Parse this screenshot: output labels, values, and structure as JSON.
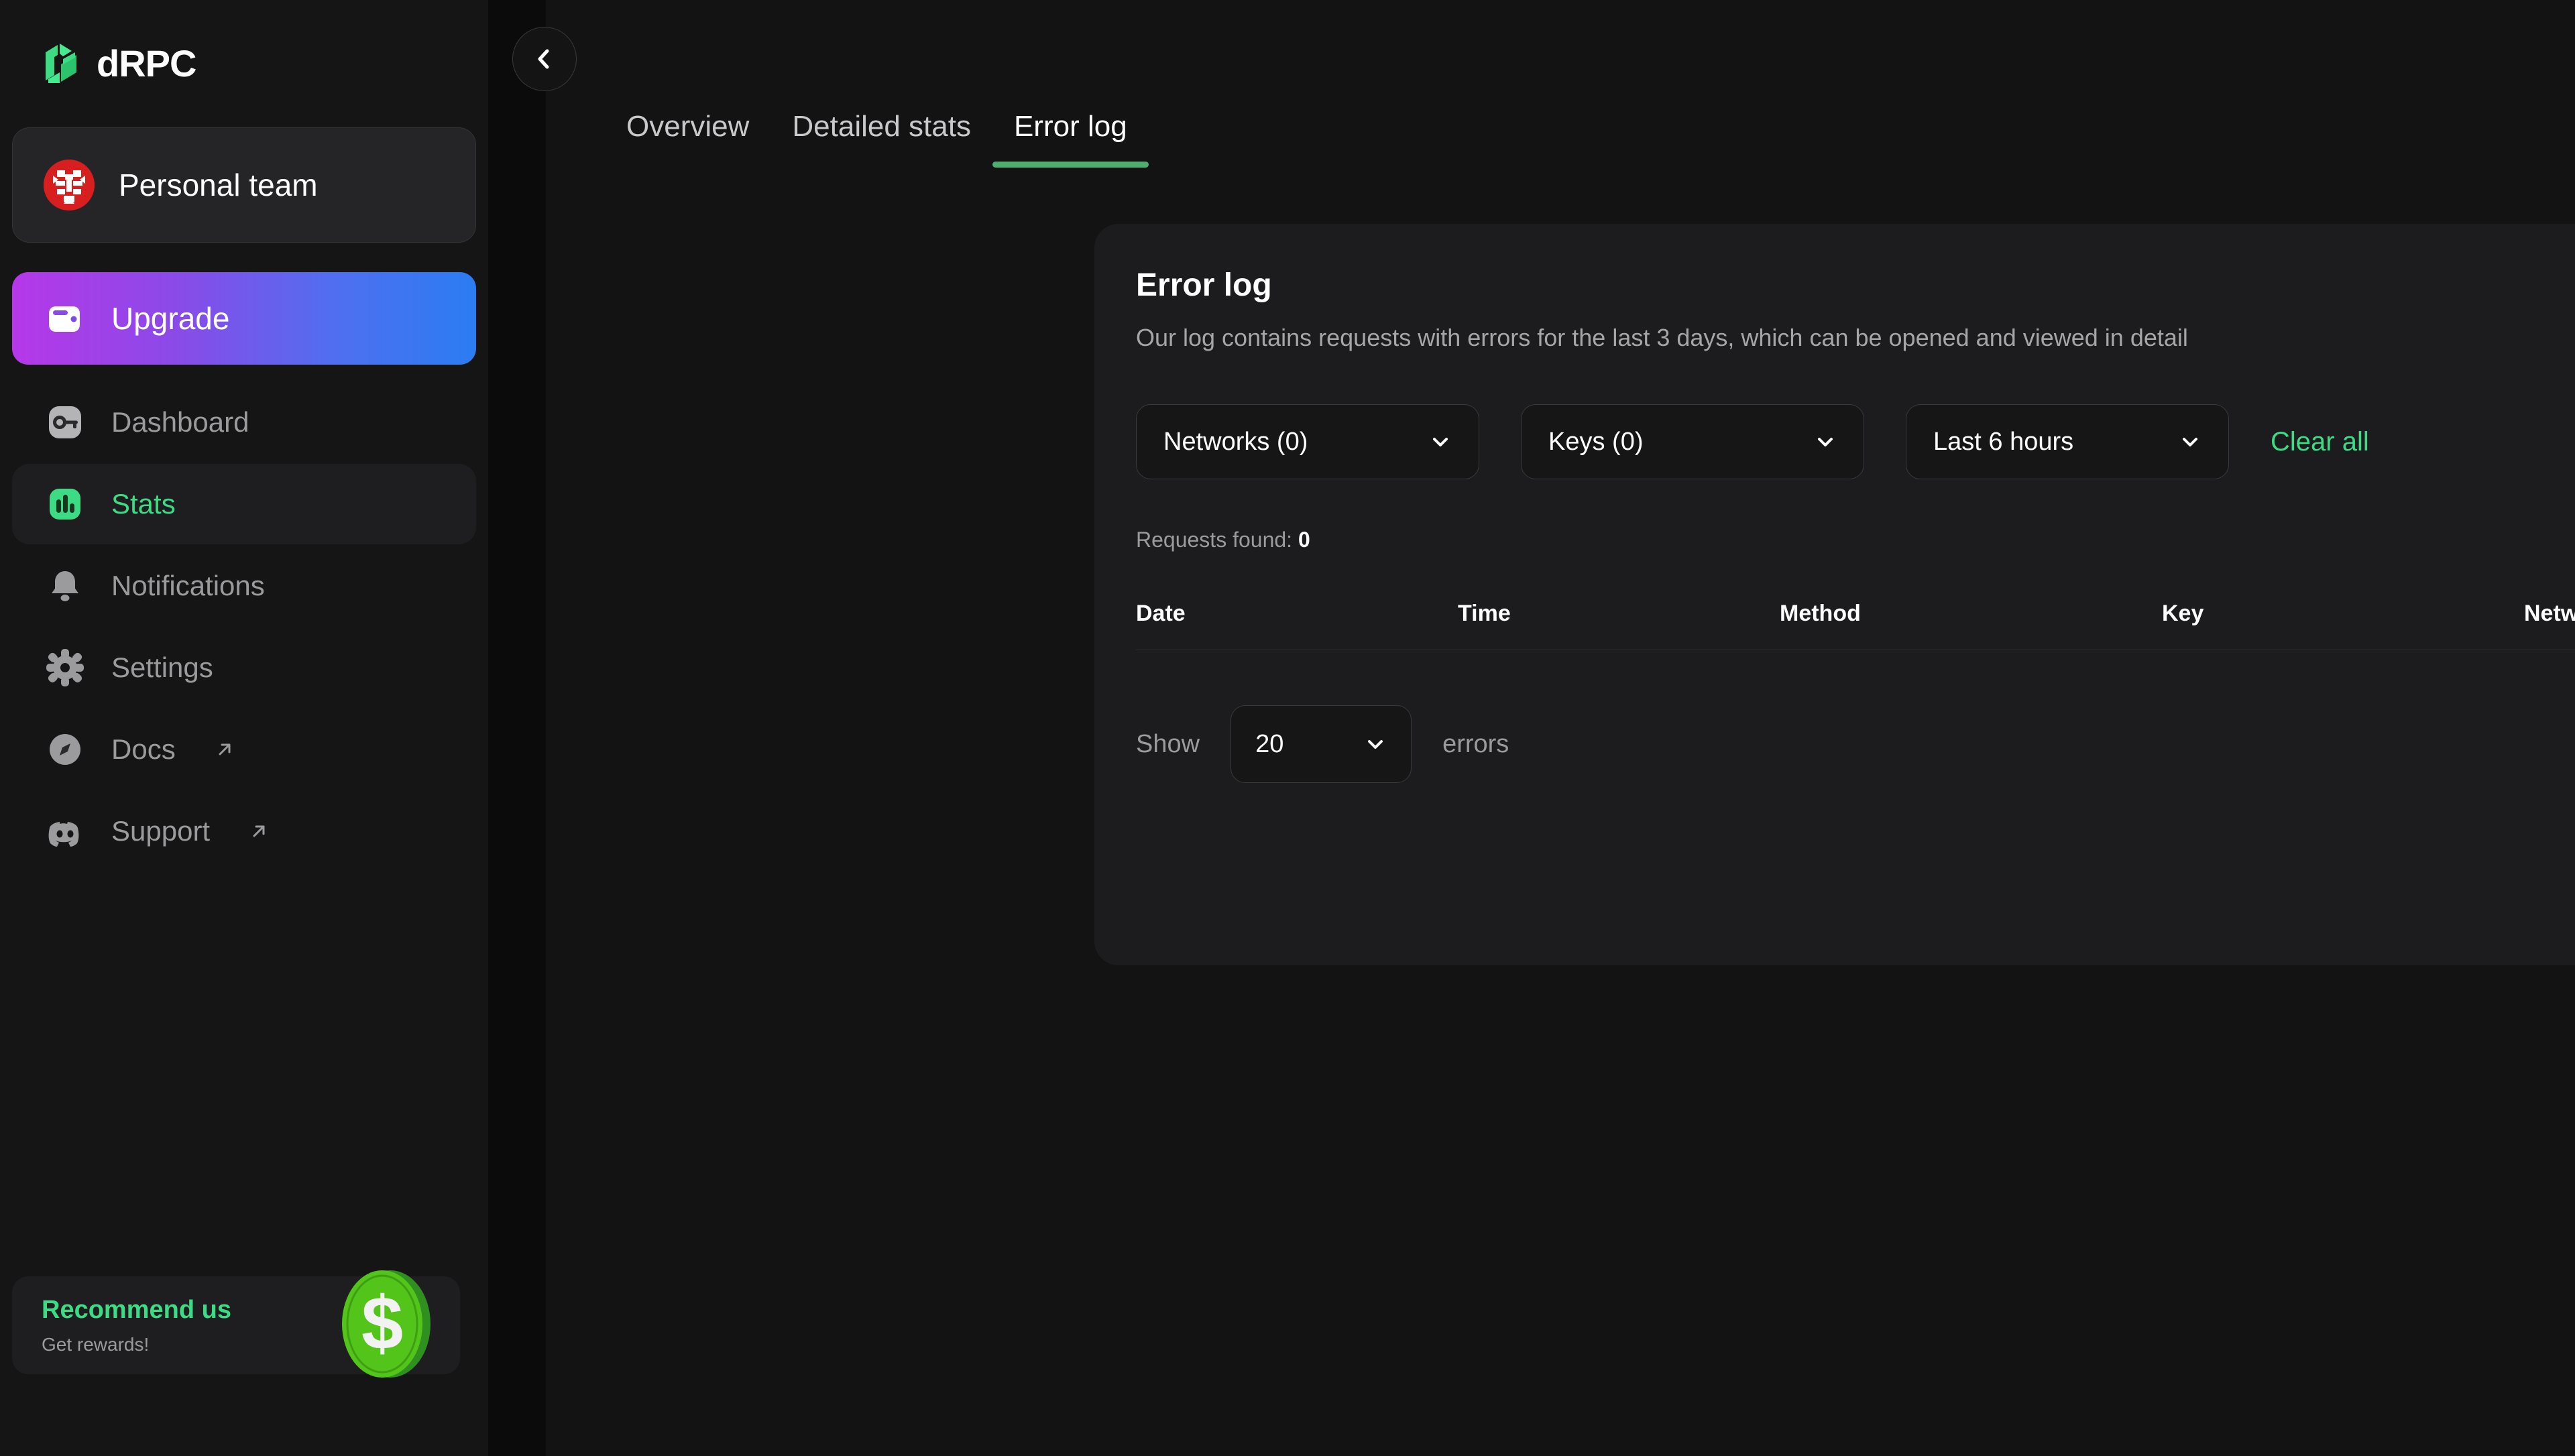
{
  "brand": {
    "name": "dRPC",
    "logo_icon": "drpc-cube-logo"
  },
  "sidebar": {
    "team": {
      "label": "Personal team",
      "avatar_icon": "team-avatar",
      "avatar_color": "#d81f1f"
    },
    "items": [
      {
        "label": "Upgrade",
        "icon": "wallet-icon",
        "state": "promo"
      },
      {
        "label": "Dashboard",
        "icon": "key-icon",
        "state": "default"
      },
      {
        "label": "Stats",
        "icon": "bar-chart-icon",
        "state": "active"
      },
      {
        "label": "Notifications",
        "icon": "bell-icon",
        "state": "default"
      },
      {
        "label": "Settings",
        "icon": "gear-icon",
        "state": "default"
      },
      {
        "label": "Docs",
        "icon": "compass-icon",
        "state": "default",
        "external": true
      },
      {
        "label": "Support",
        "icon": "discord-icon",
        "state": "default",
        "external": true
      }
    ],
    "external_icon": "external-link-arrow-icon",
    "promo": {
      "title": "Recommend us",
      "subtitle": "Get rewards!",
      "icon": "dollar-coin-icon"
    }
  },
  "header": {
    "collapse_icon": "chevron-left-icon",
    "tabs": [
      {
        "label": "Overview",
        "active": false
      },
      {
        "label": "Detailed stats",
        "active": false
      },
      {
        "label": "Error log",
        "active": true
      }
    ]
  },
  "error_log": {
    "title": "Error log",
    "description": "Our log contains requests with errors for the last 3 days, which can be opened and viewed in detail",
    "filters": {
      "networks": {
        "value": "Networks (0)",
        "chevron": "chevron-down-icon"
      },
      "keys": {
        "value": "Keys (0)",
        "chevron": "chevron-down-icon"
      },
      "range": {
        "value": "Last 6 hours",
        "chevron": "chevron-down-icon"
      },
      "clear_all": "Clear all"
    },
    "requests_found_label": "Requests found:",
    "requests_found_value": "0",
    "columns": [
      "Date",
      "Time",
      "Method",
      "Key",
      "Network"
    ],
    "rows": [],
    "pagination": {
      "show_label": "Show",
      "page_size": "20",
      "chevron": "chevron-down-icon",
      "suffix": "errors"
    }
  },
  "colors": {
    "accent_green": "#3ddc84",
    "tab_underline": "#4caf6f",
    "page_bg": "#131314",
    "sidebar_bg": "#151515",
    "card_bg": "#1c1c1e"
  }
}
